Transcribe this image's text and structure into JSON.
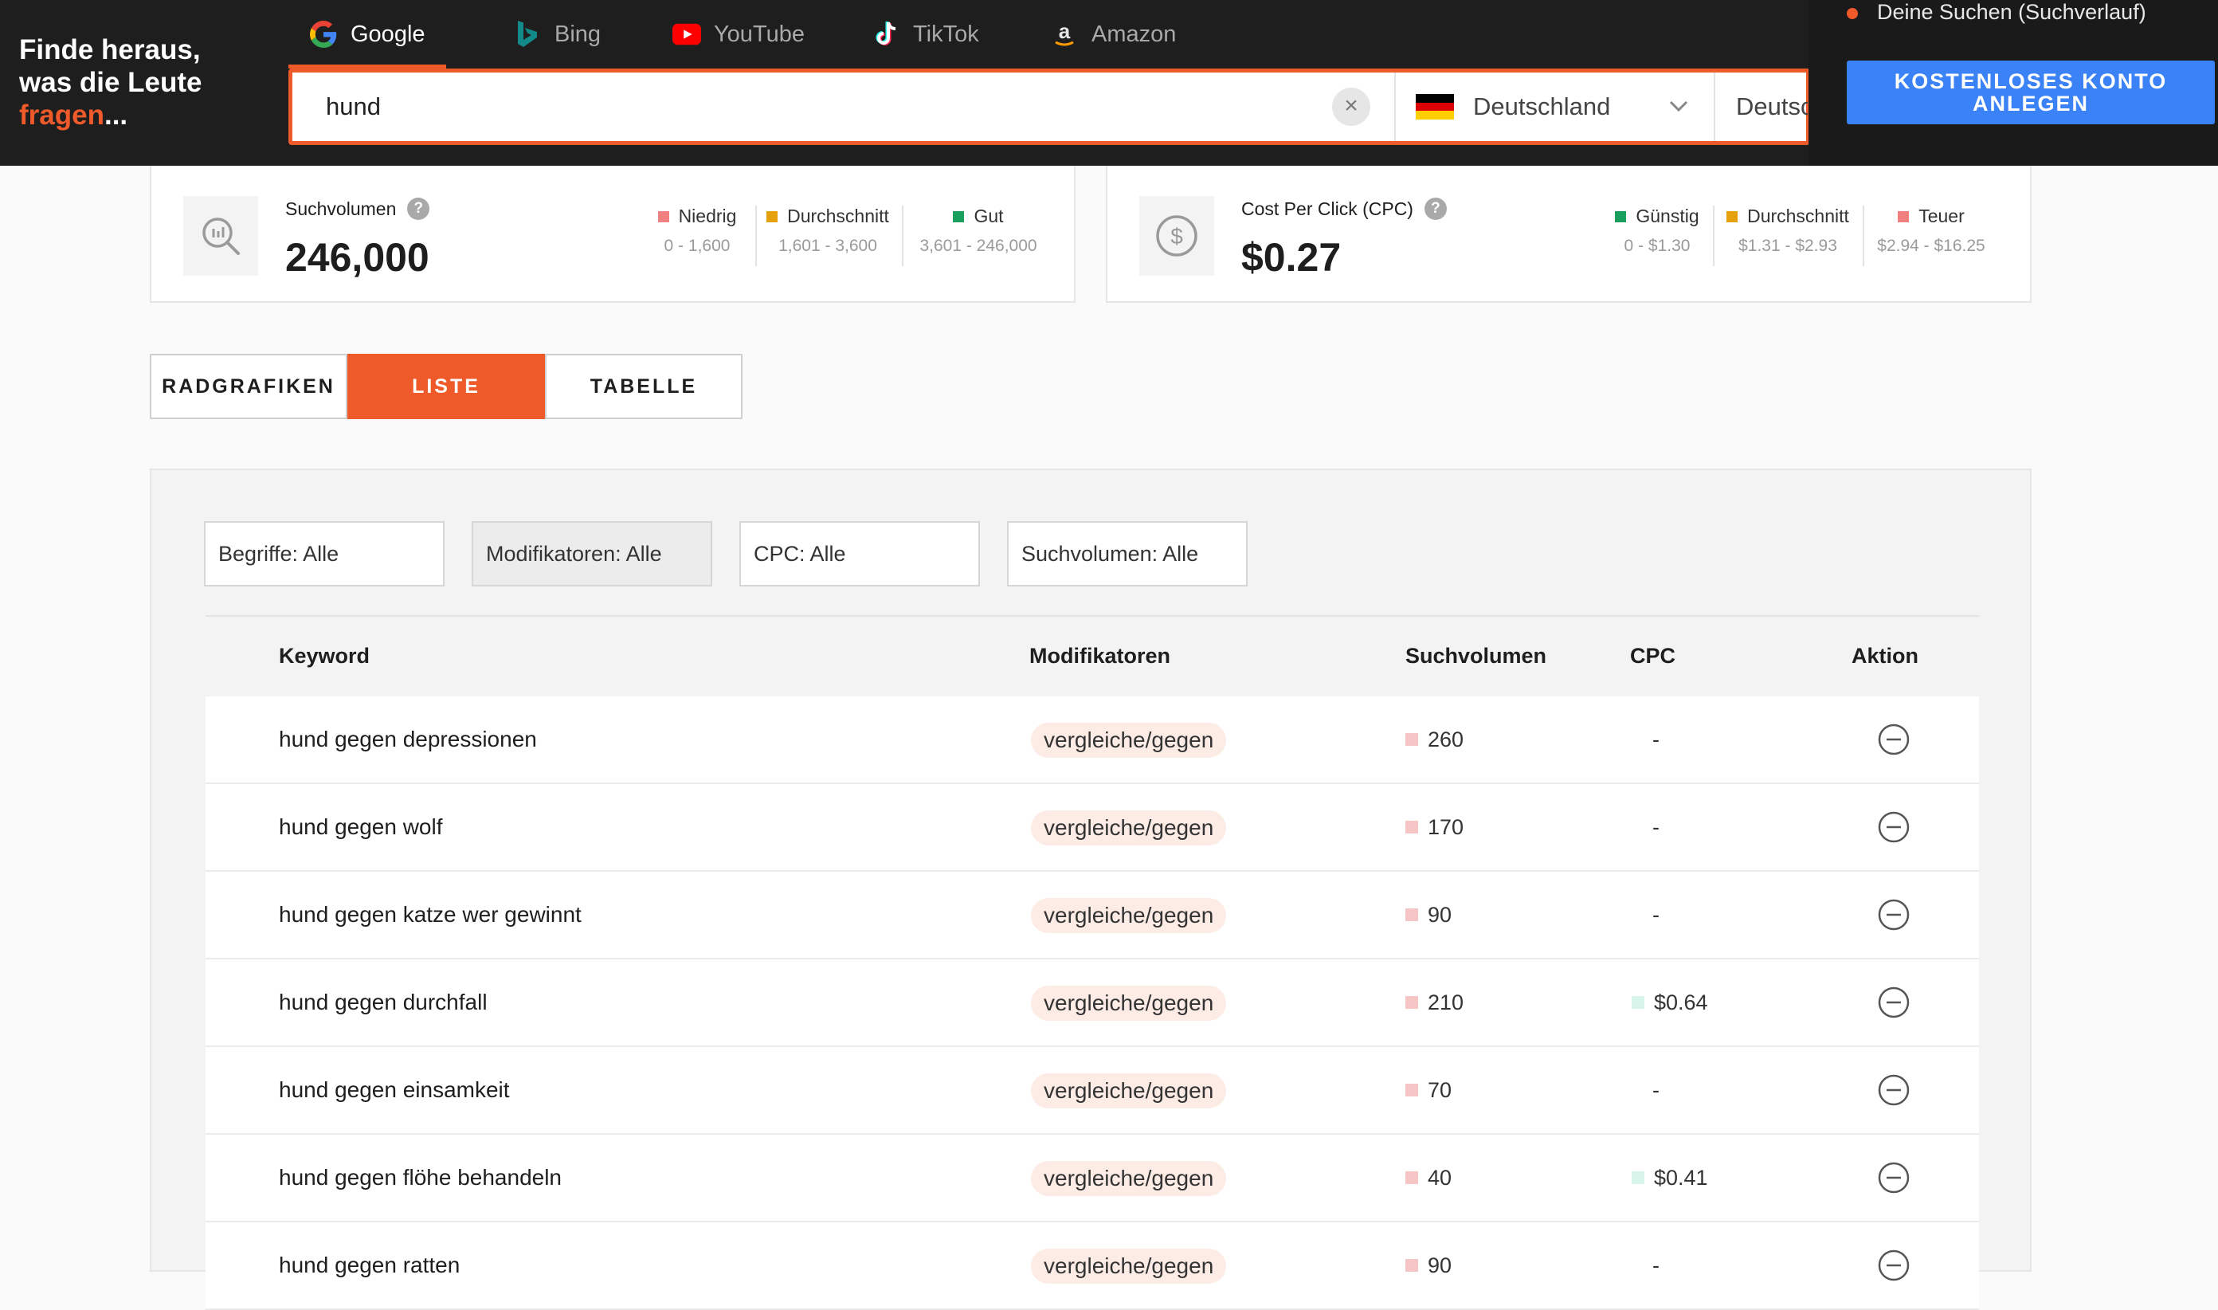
{
  "brand": {
    "line1": "Finde heraus,",
    "line2": "was die Leute",
    "line3_accent": "fragen",
    "line3_suffix": "..."
  },
  "engines": [
    {
      "label": "Google",
      "icon": "google-icon",
      "active": true
    },
    {
      "label": "Bing",
      "icon": "bing-icon",
      "active": false
    },
    {
      "label": "YouTube",
      "icon": "youtube-icon",
      "active": false
    },
    {
      "label": "TikTok",
      "icon": "tiktok-icon",
      "active": false
    },
    {
      "label": "Amazon",
      "icon": "amazon-icon",
      "active": false
    }
  ],
  "search": {
    "query": "hund",
    "country": "Deutschland",
    "language": "Deutsch"
  },
  "header_right": {
    "history_link": "Deine Suchen (Suchverlauf)",
    "cta_line1": "KOSTENLOSES KONTO",
    "cta_line2": "ANLEGEN"
  },
  "metrics": {
    "volume": {
      "label": "Suchvolumen",
      "value": "246,000",
      "legend": [
        {
          "name": "Niedrig",
          "range": "0 - 1,600",
          "color": "#f08080"
        },
        {
          "name": "Durchschnitt",
          "range": "1,601 - 3,600",
          "color": "#e5a00d"
        },
        {
          "name": "Gut",
          "range": "3,601 - 246,000",
          "color": "#1a9e5c"
        }
      ]
    },
    "cpc": {
      "label": "Cost Per Click (CPC)",
      "value": "$0.27",
      "legend": [
        {
          "name": "Günstig",
          "range": "0 - $1.30",
          "color": "#1a9e5c"
        },
        {
          "name": "Durchschnitt",
          "range": "$1.31 - $2.93",
          "color": "#e5a00d"
        },
        {
          "name": "Teuer",
          "range": "$2.94 - $16.25",
          "color": "#f08080"
        }
      ]
    }
  },
  "tabs": [
    {
      "label": "RADGRAFIKEN",
      "active": false
    },
    {
      "label": "LISTE",
      "active": true
    },
    {
      "label": "TABELLE",
      "active": false
    }
  ],
  "filters": [
    "Begriffe: Alle",
    "Modifikatoren: Alle",
    "CPC: Alle",
    "Suchvolumen: Alle"
  ],
  "table": {
    "headers": {
      "keyword": "Keyword",
      "modifier": "Modifikatoren",
      "volume": "Suchvolumen",
      "cpc": "CPC",
      "action": "Aktion"
    },
    "rows": [
      {
        "keyword": "hund gegen depressionen",
        "modifier": "vergleiche/gegen",
        "volume": "260",
        "cpc": "-"
      },
      {
        "keyword": "hund gegen wolf",
        "modifier": "vergleiche/gegen",
        "volume": "170",
        "cpc": "-"
      },
      {
        "keyword": "hund gegen katze wer gewinnt",
        "modifier": "vergleiche/gegen",
        "volume": "90",
        "cpc": "-"
      },
      {
        "keyword": "hund gegen durchfall",
        "modifier": "vergleiche/gegen",
        "volume": "210",
        "cpc": "$0.64"
      },
      {
        "keyword": "hund gegen einsamkeit",
        "modifier": "vergleiche/gegen",
        "volume": "70",
        "cpc": "-"
      },
      {
        "keyword": "hund gegen flöhe behandeln",
        "modifier": "vergleiche/gegen",
        "volume": "40",
        "cpc": "$0.41"
      },
      {
        "keyword": "hund gegen ratten",
        "modifier": "vergleiche/gegen",
        "volume": "90",
        "cpc": "-"
      }
    ]
  },
  "colors": {
    "accent": "#ef5a2b",
    "dark": "#1e1e1e",
    "cta": "#3b82f6",
    "low_marker": "#f6c6c6",
    "cpc_marker": "#d9f4ea"
  }
}
